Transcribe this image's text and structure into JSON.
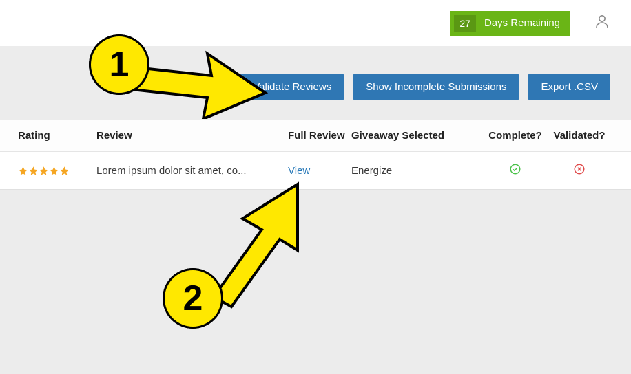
{
  "topbar": {
    "days_count": "27",
    "days_label": "Days Remaining"
  },
  "actions": {
    "validate": "Validate Reviews",
    "show_incomplete": "Show Incomplete Submissions",
    "export": "Export .CSV"
  },
  "table": {
    "headers": {
      "rating": "Rating",
      "review": "Review",
      "full_review": "Full Review",
      "giveaway": "Giveaway Selected",
      "complete": "Complete?",
      "validated": "Validated?"
    },
    "row": {
      "rating_stars": 5,
      "review_text": "Lorem ipsum dolor sit amet, co...",
      "full_review_link": "View",
      "giveaway_selected": "Energize",
      "complete": true,
      "validated": false
    }
  },
  "annotations": {
    "one": "1",
    "two": "2"
  }
}
